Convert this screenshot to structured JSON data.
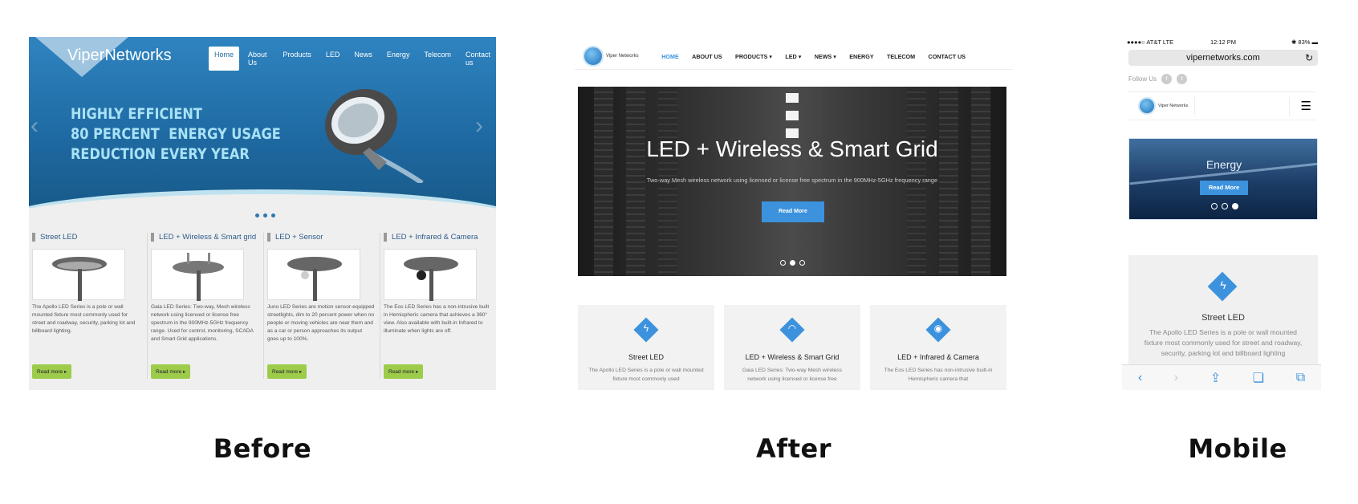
{
  "captions": {
    "before": "Before",
    "after": "After",
    "mobile": "Mobile"
  },
  "before": {
    "logo": "ViperNetworks",
    "nav": [
      "Home",
      "About Us",
      "Products",
      "LED",
      "News",
      "Energy",
      "Telecom",
      "Contact us"
    ],
    "active_nav": "Home",
    "tagline": "HIGHLY EFFICIENT\n80 PERCENT  ENERGY USAGE\nREDUCTION EVERY YEAR",
    "read_more": "Read more",
    "columns": [
      {
        "title": "Street LED",
        "text": "The Apollo LED Series is a pole or wall mounted fixture most commonly used for street and roadway, security, parking lot and billboard lighting."
      },
      {
        "title": "LED + Wireless & Smart grid",
        "text": "Gaia LED Series: Two-way, Mesh wireless network using licensed or license free spectrum in the 900MHz-5GHz frequency range. Used for control, monitoring, SCADA and Smart Grid applications."
      },
      {
        "title": "LED + Sensor",
        "text": "Juno LED Series are motion sensor-equipped streetlights, dim to 20 percent power when no people or moving vehicles are near them and as a car or person approaches its output goes up to 100%."
      },
      {
        "title": "LED + Infrared & Camera",
        "text": "The Eos LED Series has a non-intrusive built in Hemispheric camera that achieves a 360° view. Also available with built-in Infrared to illuminate when lights are off."
      }
    ],
    "colors": {
      "hero": "#1f6aa3",
      "button": "#9dcb4a",
      "tagline": "#a9e2f6"
    }
  },
  "after": {
    "logo": "Viper Networks",
    "nav": [
      "HOME",
      "ABOUT US",
      "PRODUCTS ▾",
      "LED ▾",
      "NEWS ▾",
      "ENERGY",
      "TELECOM",
      "CONTACT US"
    ],
    "slide_title": "LED + Wireless & Smart Grid",
    "slide_sub": "Two-way Mesh wireless network using licensed or license free spectrum in the 900MHz-5GHz frequency range",
    "slide_button": "Read More",
    "cards": [
      {
        "icon": "bolt-icon",
        "glyph": "ϟ",
        "title": "Street LED",
        "text": "The Apollo LED Series is a pole or wall mounted fixture most commonly used"
      },
      {
        "icon": "wifi-icon",
        "glyph": "◠",
        "title": "LED + Wireless & Smart Grid",
        "text": "Gaia LED Series: Two-way Mesh wireless network using licensed or license free"
      },
      {
        "icon": "camera-icon",
        "glyph": "◉",
        "title": "LED + Infrared & Camera",
        "text": "The Eos LED Series has non-intrusive built-in Hemispheric camera that"
      }
    ],
    "colors": {
      "accent": "#3c92dd"
    }
  },
  "mobile": {
    "carrier": "●●●●○ AT&T  LTE",
    "time": "12:12 PM",
    "battery": "✱ 83% ▬",
    "url": "vipernetworks.com",
    "follow": "Follow Us",
    "logo": "Viper Networks",
    "slide_title": "Energy",
    "slide_button": "Read More",
    "card_title": "Street LED",
    "card_text": "The Apollo LED Series is a pole or wall mounted fixture most commonly used for street and roadway, security, parking lot and billboard lighting"
  }
}
